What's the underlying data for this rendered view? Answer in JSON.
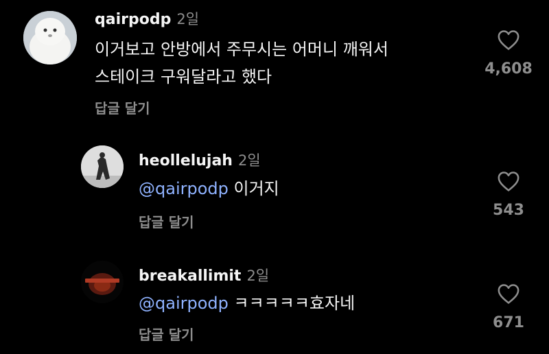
{
  "colors": {
    "background": "#000000",
    "text": "#f5f5f5",
    "muted": "#8e8e8e",
    "mention": "#8fb2ff"
  },
  "comments": [
    {
      "username": "qairpodp",
      "time": "2일",
      "lines": [
        "이거보고 안방에서 주무시는 어머니 깨워서",
        "스테이크 구워달라고 했다"
      ],
      "reply_label": "답글 달기",
      "likes": "4,608",
      "avatar_icon": "white-plush-avatar"
    },
    {
      "username": "heollelujah",
      "time": "2일",
      "mention": "@qairpodp",
      "text": "이거지",
      "reply_label": "답글 달기",
      "likes": "543",
      "avatar_icon": "figure-silhouette-avatar"
    },
    {
      "username": "breakallimit",
      "time": "2일",
      "mention": "@qairpodp",
      "text": "ㅋㅋㅋㅋㅋ효자네",
      "reply_label": "답글 달기",
      "likes": "671",
      "avatar_icon": "dark-red-logo-avatar"
    }
  ]
}
